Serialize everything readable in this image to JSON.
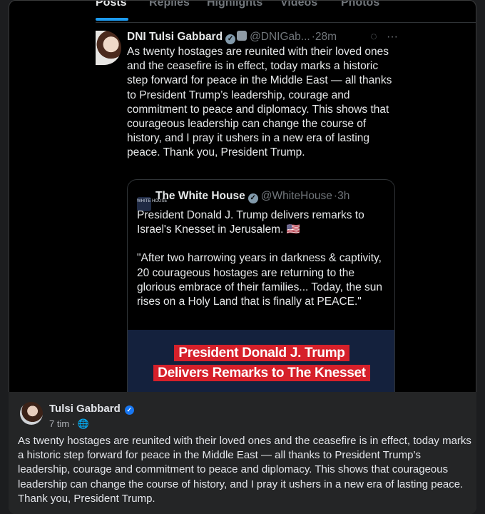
{
  "tabs": [
    {
      "label": "Posts"
    },
    {
      "label": "Replies"
    },
    {
      "label": "Highlights"
    },
    {
      "label": "Videos"
    },
    {
      "label": "Photos"
    }
  ],
  "tweet": {
    "name": "DNI Tulsi Gabbard",
    "handle": "@DNIGab...",
    "time": "·28m",
    "text": "As twenty hostages are reunited with their loved ones and the ceasefire is in effect, today marks a historic step forward for peace in the Middle East — all thanks to President Trump’s leadership, courage and commitment to peace and diplomacy. This shows that courageous leadership can change the course of history, and I pray it ushers in a new era of lasting peace. Thank you, President Trump."
  },
  "quote": {
    "name": "The White House",
    "handle": "@WhiteHouse",
    "time": "·3h",
    "logo_text": "WHITE HOUSE",
    "text1": "President Donald J. Trump delivers remarks to Israel's Knesset in Jerusalem. 🇺🇸",
    "text2": "\"After two harrowing years in darkness & captivity, 20 courageous hostages are returning to the glorious embrace of their families... Today, the sun rises on a Holy Land that is finally at PEACE.\"",
    "banner1": "President Donald J. Trump",
    "banner2": "Delivers Remarks to The Knesset"
  },
  "fb_post": {
    "author": "Tulsi Gabbard",
    "time": "7 tim ·",
    "text": "As twenty hostages are reunited with their loved ones and the ceasefire is in effect, today marks a historic step forward for peace in the Middle East — all thanks to President Trump’s leadership, courage and commitment to peace and diplomacy. This shows that courageous leadership can change the course of history, and I pray it ushers in a new era of lasting peace. Thank you, President Trump."
  },
  "colors": {
    "accent": "#1d9bf0",
    "fb_blue": "#1877f2",
    "banner_red": "#d6202a"
  }
}
